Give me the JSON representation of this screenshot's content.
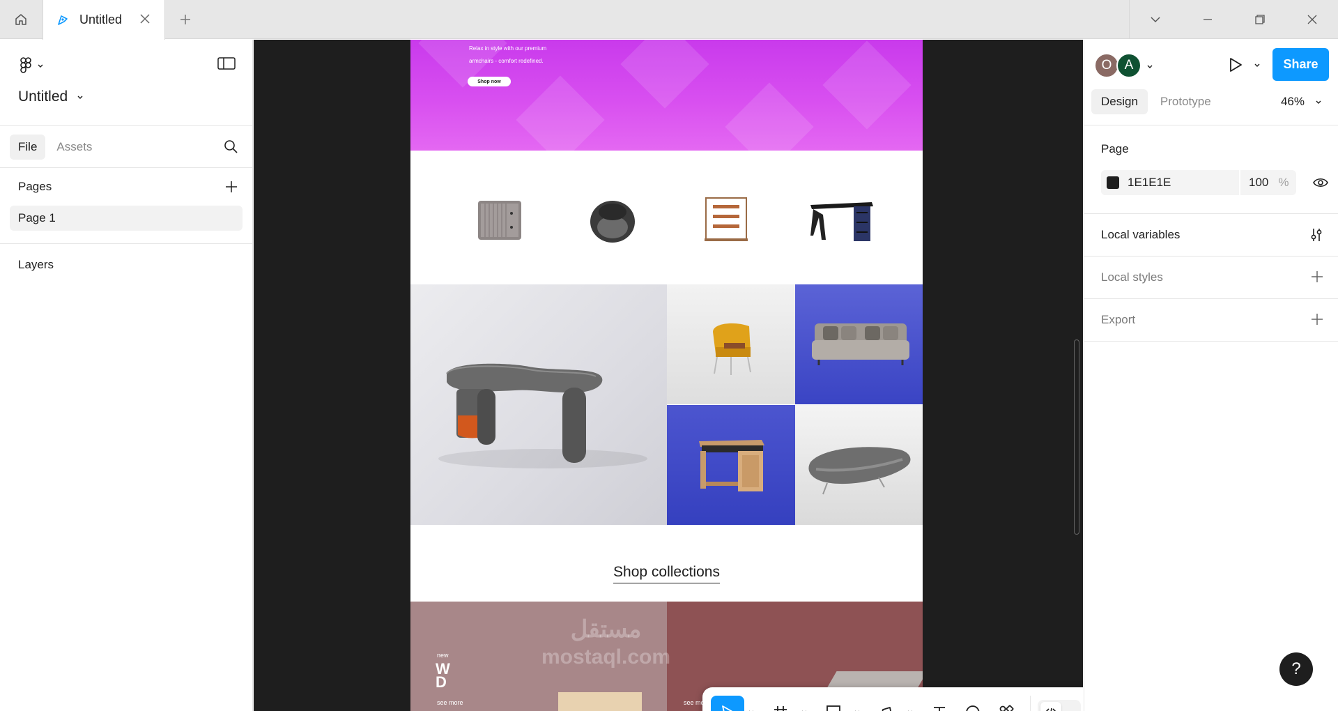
{
  "titlebar": {
    "tab_title": "Untitled"
  },
  "left_panel": {
    "file_name": "Untitled",
    "tabs": [
      "File",
      "Assets"
    ],
    "pages_label": "Pages",
    "pages": [
      "Page 1"
    ],
    "layers_label": "Layers"
  },
  "canvas": {
    "hero_text_line1": "Relax in style with our premium",
    "hero_text_line2": "armchairs - comfort redefined.",
    "hero_button": "Shop now",
    "collections_title": "Shop collections",
    "bottom_left_small": "new",
    "bottom_left_big1": "W",
    "bottom_left_big2": "D",
    "see_more_left": "see more",
    "see_more_right": "see more",
    "watermark_ar": "مستقل",
    "watermark_url": "mostaql.com"
  },
  "right_panel": {
    "avatars": [
      "O",
      "A"
    ],
    "share_label": "Share",
    "tabs": [
      "Design",
      "Prototype"
    ],
    "zoom": "46%",
    "page_label": "Page",
    "page_color_hex": "1E1E1E",
    "page_opacity": "100",
    "opacity_unit": "%",
    "local_variables": "Local variables",
    "local_styles": "Local styles",
    "export": "Export"
  },
  "help_label": "?",
  "colors": {
    "accent": "#0d99ff",
    "canvas_bg": "#1e1e1e",
    "hero_magenta": "#d84ff0",
    "gallery_blue": "#3a44c4"
  }
}
